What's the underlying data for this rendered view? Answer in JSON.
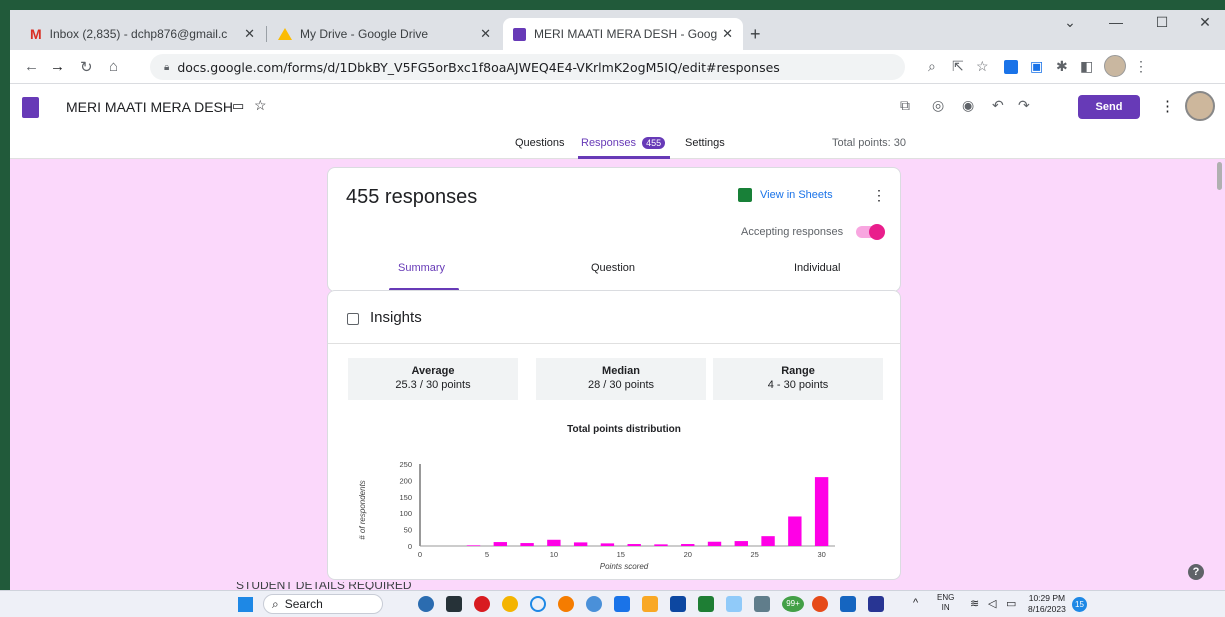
{
  "tabs": [
    {
      "label": "Inbox (2,835) - dchp876@gmail.c"
    },
    {
      "label": "My Drive - Google Drive"
    },
    {
      "label": "MERI MAATI MERA DESH - Goog"
    }
  ],
  "address": {
    "url": "docs.google.com/forms/d/1DbkBY_V5FG5orBxc1f8oaAJWEQ4E4-VKrlmK2ogM5IQ/edit#responses"
  },
  "form": {
    "title": "MERI MAATI MERA DESH",
    "send_label": "Send",
    "nav": {
      "questions": "Questions",
      "responses": "Responses",
      "responses_count": "455",
      "settings": "Settings",
      "total_points": "Total points: 30"
    }
  },
  "responses": {
    "count_label": "455 responses",
    "view_sheets": "View in Sheets",
    "accepting": "Accepting responses",
    "subtabs": [
      "Summary",
      "Question",
      "Individual"
    ]
  },
  "insights": {
    "title": "Insights",
    "stats": [
      {
        "label": "Average",
        "value": "25.3 / 30 points"
      },
      {
        "label": "Median",
        "value": "28 / 30 points"
      },
      {
        "label": "Range",
        "value": "4 - 30 points"
      }
    ]
  },
  "chart_data": {
    "type": "bar",
    "title": "Total points distribution",
    "xlabel": "Points scored",
    "ylabel": "# of respondents",
    "x": [
      4,
      6,
      8,
      10,
      12,
      14,
      16,
      18,
      20,
      22,
      24,
      26,
      28,
      30
    ],
    "values": [
      2,
      12,
      9,
      19,
      11,
      8,
      6,
      5,
      6,
      13,
      15,
      30,
      90,
      210
    ],
    "xticks": [
      0,
      5,
      10,
      15,
      20,
      25,
      30
    ],
    "yticks": [
      0,
      50,
      100,
      150,
      200,
      250
    ],
    "xlim": [
      0,
      31
    ],
    "ylim": [
      0,
      250
    ],
    "color": "#ff00e6"
  },
  "bottom_text": "STUDENT DETAILS REQUIRED",
  "taskbar": {
    "search": "Search",
    "lang": "ENG",
    "region": "IN",
    "time": "10:29 PM",
    "date": "8/16/2023",
    "badge": "99+",
    "notif": "15"
  },
  "colors": {
    "brand": "#673ab7",
    "pink_bg": "#fbd8fb",
    "toggle": "#e91e8c"
  }
}
